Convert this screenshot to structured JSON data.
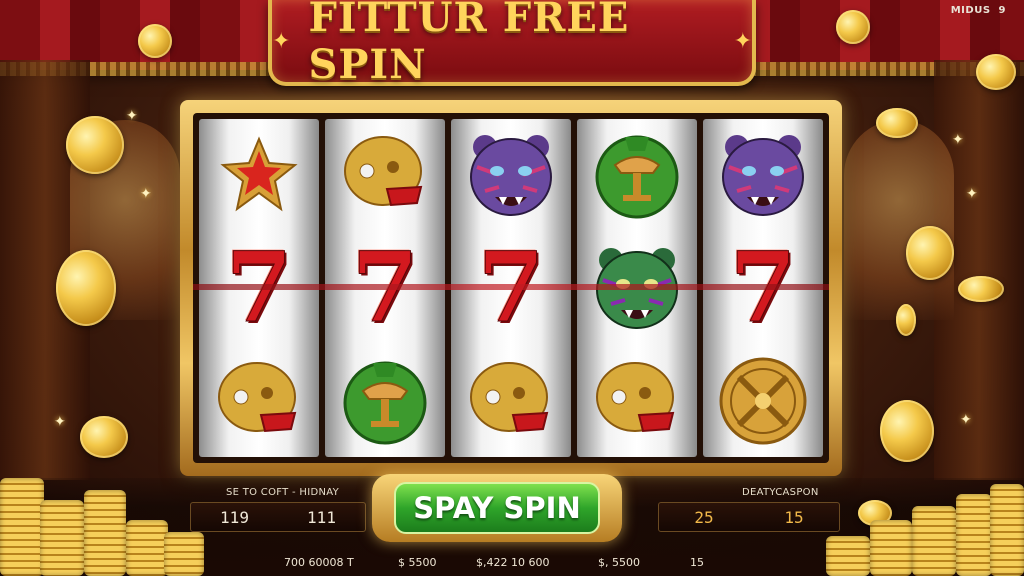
{
  "title": "FITTUR FREE SPIN",
  "corner_badge": {
    "label": "MIDUS",
    "number": "9"
  },
  "reels": [
    [
      "star-badge-icon",
      "seven",
      "gold-skull-helmet-icon"
    ],
    [
      "gold-skull-helmet-icon",
      "seven",
      "green-emblem-icon"
    ],
    [
      "purple-tiger-icon",
      "seven",
      "gold-skull-helmet-icon"
    ],
    [
      "green-emblem-icon",
      "green-tiger-icon",
      "gold-skull-helmet-icon"
    ],
    [
      "purple-tiger-icon",
      "seven",
      "gold-crest-icon"
    ]
  ],
  "seven_glyph": "7",
  "left_panel": {
    "label": "SE TO COFT - HIDNAY",
    "values": [
      "119",
      "111"
    ]
  },
  "right_panel": {
    "label": "DEATYCASPON",
    "values": [
      "25",
      "15"
    ]
  },
  "spin_button_label": "SPAY SPIN",
  "bottom_stats": [
    "700 60008 T",
    "$ 5500",
    "$,422 10 600",
    "$, 5500",
    "15"
  ],
  "colors": {
    "accent_gold": "#ffd45c",
    "spin_green": "#2fa52a",
    "seven_red": "#d3191f",
    "banner_red": "#b01c22"
  }
}
